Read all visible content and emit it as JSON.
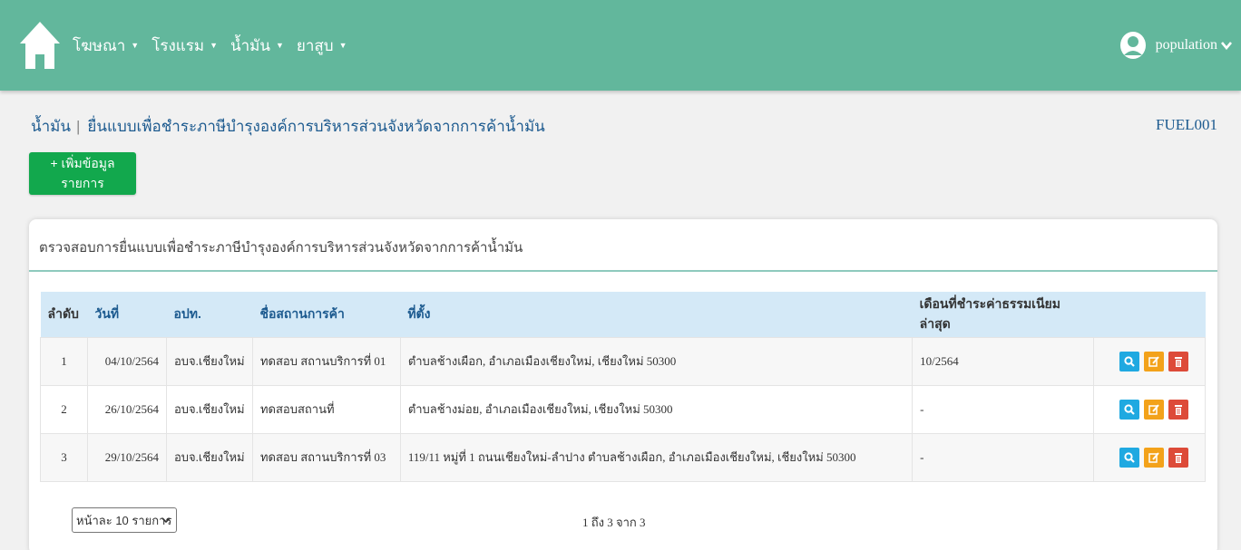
{
  "nav": {
    "menu": [
      {
        "label": "โฆษณา"
      },
      {
        "label": "โรงแรม"
      },
      {
        "label": "น้ำมัน"
      },
      {
        "label": "ยาสูบ"
      }
    ],
    "user": "population",
    "icons": {
      "home": "home-icon",
      "user": "user-icon",
      "menu_caret": "caret-down-icon",
      "user_chevron": "chevron-down-icon"
    }
  },
  "page": {
    "breadcrumb_root": "น้ำมัน",
    "breadcrumb_sep": "|",
    "title": "ยื่นแบบเพื่อชำระภาษีบำรุงองค์การบริหารส่วนจังหวัดจากการค้าน้ำมัน",
    "code": "FUEL001",
    "add_button": "+ เพิ่มข้อมูลรายการ"
  },
  "card": {
    "title": "ตรวจสอบการยื่นแบบเพื่อชำระภาษีบำรุงองค์การบริหารส่วนจังหวัดจากการค้าน้ำมัน"
  },
  "table": {
    "columns": [
      "ลำดับ",
      "วันที่",
      "อปท.",
      "ชื่อสถานการค้า",
      "ที่ตั้ง",
      "เดือนที่ชำระค่าธรรมเนียมล่าสุด",
      ""
    ],
    "rows": [
      {
        "seq": "1",
        "date": "04/10/2564",
        "org": "อบจ.เชียงใหม่",
        "name": "ทดสอบ สถานบริการที่ 01",
        "location": "ตำบลช้างเผือก, อำเภอเมืองเชียงใหม่, เชียงใหม่ 50300",
        "last_month": "10/2564"
      },
      {
        "seq": "2",
        "date": "26/10/2564",
        "org": "อบจ.เชียงใหม่",
        "name": "ทดสอบสถานที่",
        "location": "ตำบลช้างม่อย, อำเภอเมืองเชียงใหม่, เชียงใหม่ 50300",
        "last_month": "-"
      },
      {
        "seq": "3",
        "date": "29/10/2564",
        "org": "อบจ.เชียงใหม่",
        "name": "ทดสอบ สถานบริการที่ 03",
        "location": "119/11 หมู่ที่ 1 ถนนเชียงใหม่-ลำปาง ตำบลช้างเผือก, อำเภอเมืองเชียงใหม่, เชียงใหม่ 50300",
        "last_month": "-"
      }
    ],
    "action_icons": [
      "search-icon",
      "edit-icon",
      "trash-icon"
    ]
  },
  "pagination": {
    "per_page": "หน้าละ 10 รายการ",
    "range": "1 ถึง 3 จาก 3"
  },
  "colors": {
    "nav": "#62b79c",
    "add_button": "#12a84d",
    "view": "#1fa9e1",
    "edit": "#f3a21a",
    "delete": "#dd4b39",
    "header_row": "#d4e9f7",
    "link": "#1c5a8f"
  }
}
